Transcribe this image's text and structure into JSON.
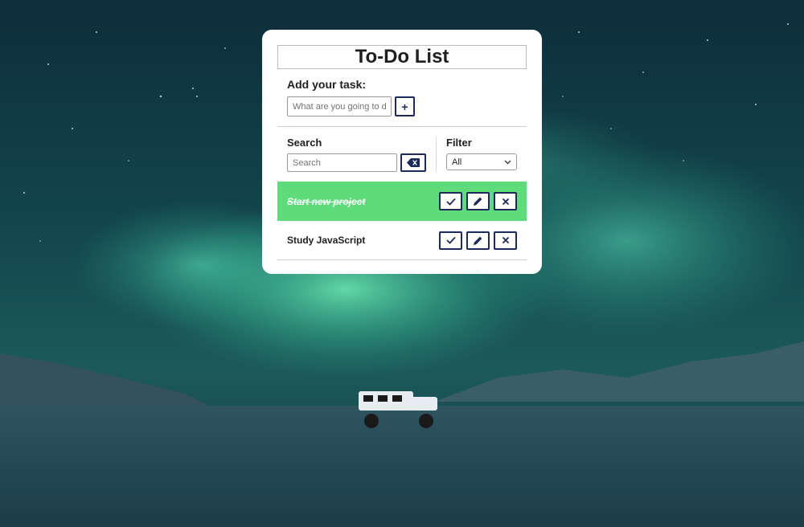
{
  "app": {
    "title": "To-Do List"
  },
  "add_task": {
    "label": "Add your task:",
    "placeholder": "What are you going to do",
    "button_label": "+"
  },
  "search": {
    "label": "Search",
    "placeholder": "Search",
    "clear_icon": "backspace-icon"
  },
  "filter": {
    "label": "Filter",
    "selected": "All"
  },
  "todos": [
    {
      "text": "Start new project",
      "done": true
    },
    {
      "text": "Study JavaScript",
      "done": false
    }
  ],
  "icons": {
    "check": "check-icon",
    "edit": "pencil-icon",
    "delete": "close-icon"
  },
  "colors": {
    "done_bg": "#5fdc7a",
    "button_border": "#1b2a5b",
    "card_bg": "#ffffff"
  }
}
